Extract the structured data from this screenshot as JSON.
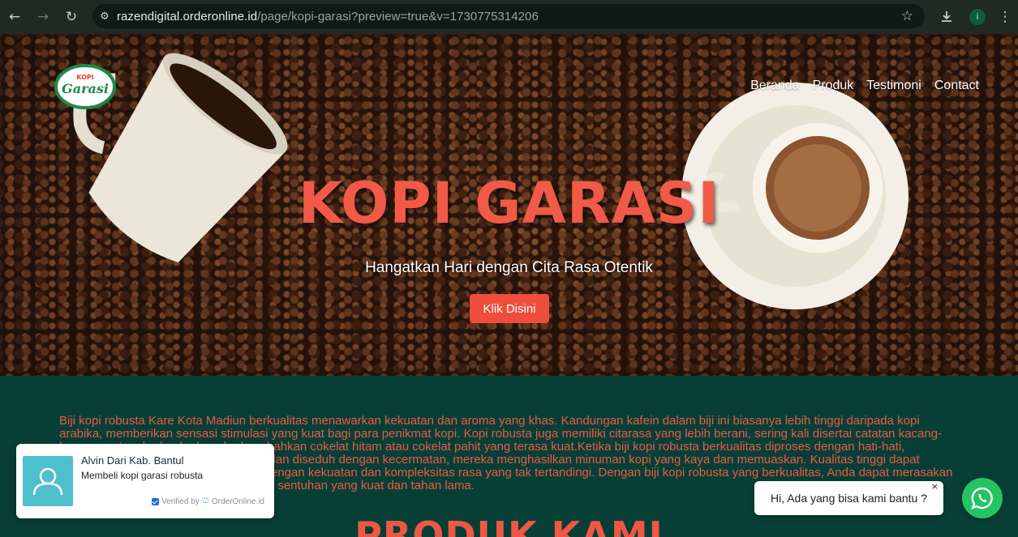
{
  "browser": {
    "back_icon": "arrow-left-icon",
    "forward_icon": "arrow-right-icon",
    "reload_icon": "reload-icon",
    "url_host": "razendigital.orderonline.id",
    "url_path": "/page/kopi-garasi?preview=true&v=1730775314206",
    "profile_initial": "i"
  },
  "nav": {
    "logo_alt": "KOPI Garasi",
    "items": [
      "Beranda",
      "Produk",
      "Testimoni",
      "Contact"
    ]
  },
  "hero": {
    "title": "KOPI GARASI",
    "subtitle": "Hangatkan Hari dengan Cita Rasa Otentik",
    "cta": "Klik Disini"
  },
  "description": "Biji kopi robusta Kare Kota Madiun berkualitas menawarkan kekuatan dan aroma yang khas. Kandungan kafein dalam biji ini biasanya lebih tinggi daripada kopi arabika, memberikan sensasi stimulasi yang kuat bagi para penikmat kopi. Kopi robusta juga memiliki citarasa yang lebih berani, sering kali disertai catatan kacang-kacangan, tanah, dan kadang-kadang bahkan cokelat hitam atau cokelat pahit yang terasa kuat.Ketika biji kopi robusta berkualitas diproses dengan hati-hati, dipanggang dengan teknik yang tepat, dan diseduh dengan kecermatan, mereka menghasilkan minuman kopi yang kaya dan memuaskan. Kualitas tinggi dapat memberikan kelezatan yang memikat dengan kekuatan dan kompleksitas rasa yang tak tertandingi. Dengan biji kopi robusta yang berkualitas, Anda dapat merasakan kekayaan cita rasa yang dalam, dengan sentuhan yang kuat dan tahan lama.",
  "section_title": "PRODUK KAMI",
  "notification": {
    "name": "Alvin Dari Kab. Bantul",
    "message": "Membeli kopi garasi robusta",
    "verified_label": "Verified by",
    "verified_brand": "OrderOnline.id"
  },
  "chat": {
    "greeting": "Hi, Ada yang bisa kami bantu ?",
    "close": "×"
  },
  "colors": {
    "accent": "#ef4e3c",
    "page_bg": "#073f37",
    "whatsapp": "#25c463"
  }
}
